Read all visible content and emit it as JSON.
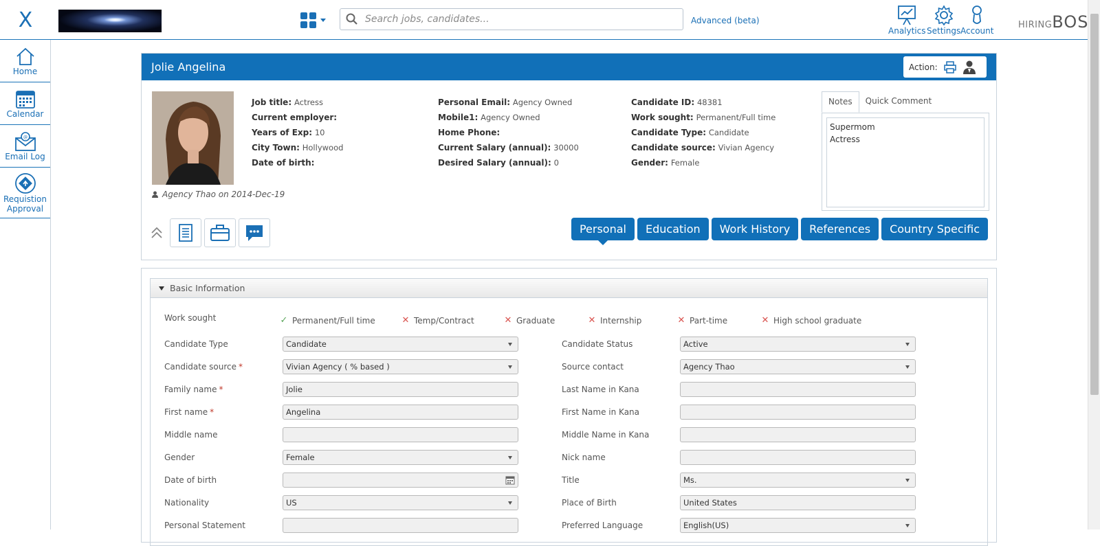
{
  "topbar": {
    "close_glyph": "X",
    "search_placeholder": "Search jobs, candidates...",
    "advanced_label": "Advanced (beta)",
    "icons": [
      {
        "name": "analytics-icon",
        "label": "Analytics"
      },
      {
        "name": "settings-icon",
        "label": "Settings"
      },
      {
        "name": "account-icon",
        "label": "Account"
      }
    ],
    "brand_small": "HIRING",
    "brand_large": "BOSS"
  },
  "sidebar": {
    "items": [
      {
        "label": "Home",
        "icon": "home-icon"
      },
      {
        "label": "Calendar",
        "icon": "calendar-icon"
      },
      {
        "label": "Email Log",
        "icon": "email-icon"
      },
      {
        "label": "Requistion Approval",
        "icon": "approval-icon"
      }
    ]
  },
  "profile": {
    "name": "Jolie Angelina",
    "action_label": "Action:",
    "byline": "Agency Thao on 2014-Dec-19",
    "col1": [
      {
        "label": "Job title:",
        "value": "Actress"
      },
      {
        "label": "Current employer:",
        "value": ""
      },
      {
        "label": "Years of Exp:",
        "value": "10"
      },
      {
        "label": "City Town:",
        "value": "Hollywood"
      },
      {
        "label": "Date of birth:",
        "value": ""
      }
    ],
    "col2": [
      {
        "label": "Personal Email:",
        "value": "Agency Owned"
      },
      {
        "label": "Mobile1:",
        "value": "Agency Owned"
      },
      {
        "label": "Home Phone:",
        "value": ""
      },
      {
        "label": "Current Salary (annual):",
        "value": "30000"
      },
      {
        "label": "Desired Salary (annual):",
        "value": "0"
      }
    ],
    "col3": [
      {
        "label": "Candidate ID:",
        "value": "48381"
      },
      {
        "label": "Work sought:",
        "value": "Permanent/Full time"
      },
      {
        "label": "Candidate Type:",
        "value": "Candidate"
      },
      {
        "label": "Candidate source:",
        "value": "Vivian Agency"
      },
      {
        "label": "Gender:",
        "value": "Female"
      }
    ],
    "notes_tabs": [
      "Notes",
      "Quick Comment"
    ],
    "notes_lines": [
      "Supermom",
      "Actress"
    ],
    "tabs": [
      "Personal",
      "Education",
      "Work History",
      "References",
      "Country Specific"
    ]
  },
  "basic": {
    "title": "Basic Information",
    "work_sought_label": "Work sought",
    "work_sought": [
      {
        "label": "Permanent/Full time",
        "checked": true
      },
      {
        "label": "Temp/Contract",
        "checked": false
      },
      {
        "label": "Graduate",
        "checked": false
      },
      {
        "label": "Internship",
        "checked": false
      },
      {
        "label": "Part-time",
        "checked": false
      },
      {
        "label": "High school graduate",
        "checked": false
      }
    ],
    "left": [
      {
        "label": "Candidate Type",
        "value": "Candidate",
        "type": "select",
        "required": false
      },
      {
        "label": "Candidate source",
        "value": "Vivian Agency ( % based )",
        "type": "select",
        "required": true
      },
      {
        "label": "Family name",
        "value": "Jolie",
        "type": "text",
        "required": true
      },
      {
        "label": "First name",
        "value": "Angelina",
        "type": "text",
        "required": true
      },
      {
        "label": "Middle name",
        "value": "",
        "type": "text",
        "required": false
      },
      {
        "label": "Gender",
        "value": "Female",
        "type": "select",
        "required": false
      },
      {
        "label": "Date of birth",
        "value": "",
        "type": "date",
        "required": false
      },
      {
        "label": "Nationality",
        "value": "US",
        "type": "select",
        "required": false
      },
      {
        "label": "Personal Statement",
        "value": "",
        "type": "text",
        "required": false
      }
    ],
    "right": [
      {
        "label": "Candidate Status",
        "value": "Active",
        "type": "select"
      },
      {
        "label": "Source contact",
        "value": "Agency Thao",
        "type": "select"
      },
      {
        "label": "Last Name in Kana",
        "value": "",
        "type": "text"
      },
      {
        "label": "First Name in Kana",
        "value": "",
        "type": "text"
      },
      {
        "label": "Middle Name in Kana",
        "value": "",
        "type": "text"
      },
      {
        "label": "Nick name",
        "value": "",
        "type": "text"
      },
      {
        "label": "Title",
        "value": "Ms.",
        "type": "select"
      },
      {
        "label": "Place of Birth",
        "value": "United States",
        "type": "text"
      },
      {
        "label": "Preferred Language",
        "value": "English(US)",
        "type": "select"
      }
    ]
  }
}
